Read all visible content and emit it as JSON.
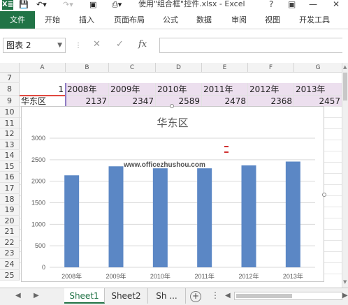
{
  "titlebar": {
    "logo": "X≣",
    "title": "使用\"组合框\"控件.xlsx - Excel",
    "help": "?",
    "minimize": "—",
    "close": "✕"
  },
  "ribbon": {
    "tabs": [
      "文件",
      "开始",
      "插入",
      "页面布局",
      "公式",
      "数据",
      "审阅",
      "视图",
      "开发工具"
    ]
  },
  "formula_bar": {
    "name_box": "图表 2",
    "fx": "fx"
  },
  "columns": [
    "A",
    "B",
    "C",
    "D",
    "E",
    "F",
    "G"
  ],
  "rows": [
    "7",
    "8",
    "9",
    "10",
    "11",
    "12",
    "13",
    "14",
    "15",
    "16",
    "17",
    "18",
    "19",
    "20",
    "21",
    "22",
    "23",
    "24",
    "25"
  ],
  "sheet": {
    "row8": [
      "1",
      "2008年",
      "2009年",
      "2010年",
      "2011年",
      "2012年",
      "2013年"
    ],
    "row9": [
      "华东区",
      "2137",
      "2347",
      "2589",
      "2478",
      "2368",
      "2457"
    ]
  },
  "chart_data": {
    "type": "bar",
    "title": "华东区",
    "categories": [
      "2008年",
      "2009年",
      "2010年",
      "2011年",
      "2012年",
      "2013年"
    ],
    "series": [
      {
        "values": [
          2137,
          2347,
          2300,
          2300,
          2368,
          2457
        ]
      }
    ],
    "yticks": [
      "3000",
      "2500",
      "2000",
      "1500",
      "1000",
      "500",
      "0"
    ],
    "ylim": [
      0,
      3000
    ],
    "grid": true,
    "bar_color": "#5b87c5",
    "watermark": "www.officezhushou.com"
  },
  "sheet_tabs": {
    "prev": "◀",
    "next": "▶",
    "tabs": [
      "Sheet1",
      "Sheet2",
      "Sh ..."
    ],
    "add": "+"
  },
  "accent_color": "#217346"
}
